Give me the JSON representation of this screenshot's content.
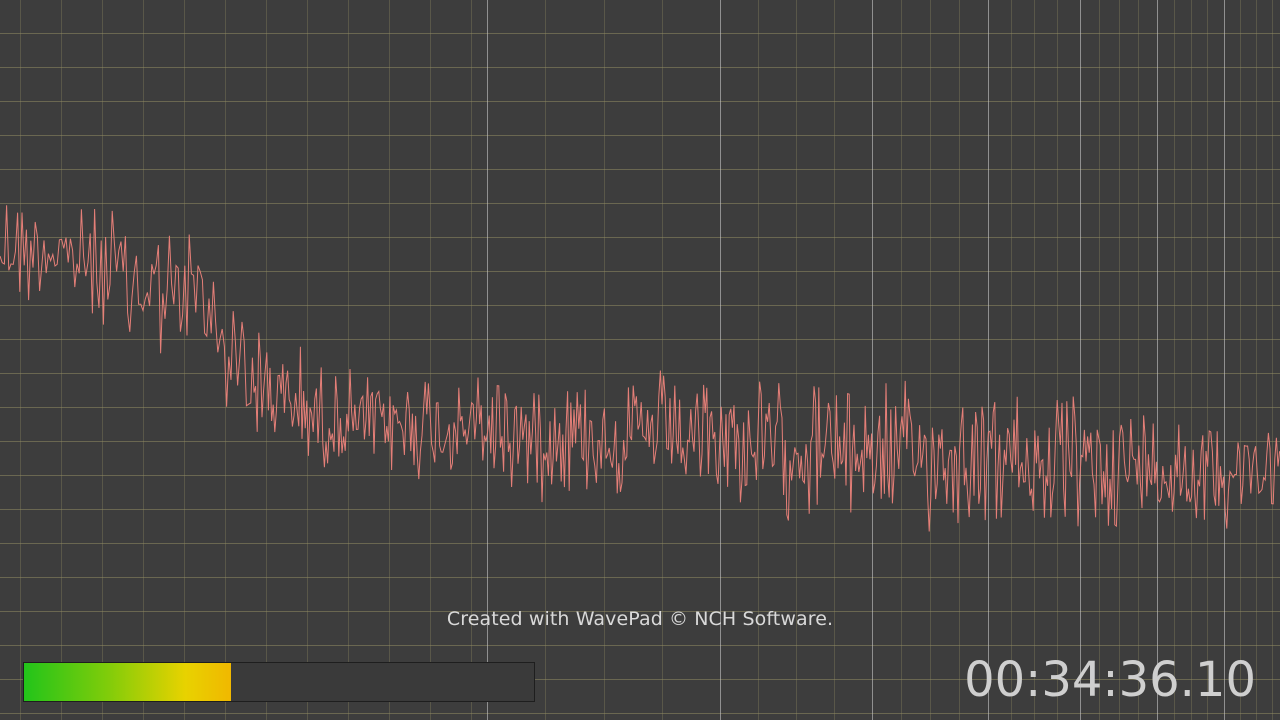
{
  "watermark": "Created with WavePad © NCH Software.",
  "timecode": "00:34:36.10",
  "level_meter": {
    "level_fraction": 0.405,
    "colors": [
      "#22c41a",
      "#e8d200",
      "#f0b800"
    ]
  },
  "display": {
    "background": "#3d3d3d",
    "trace_color": "#e57f78",
    "grid_color": "#8f8a62",
    "major_grid_color": "#c8c8c8"
  }
}
